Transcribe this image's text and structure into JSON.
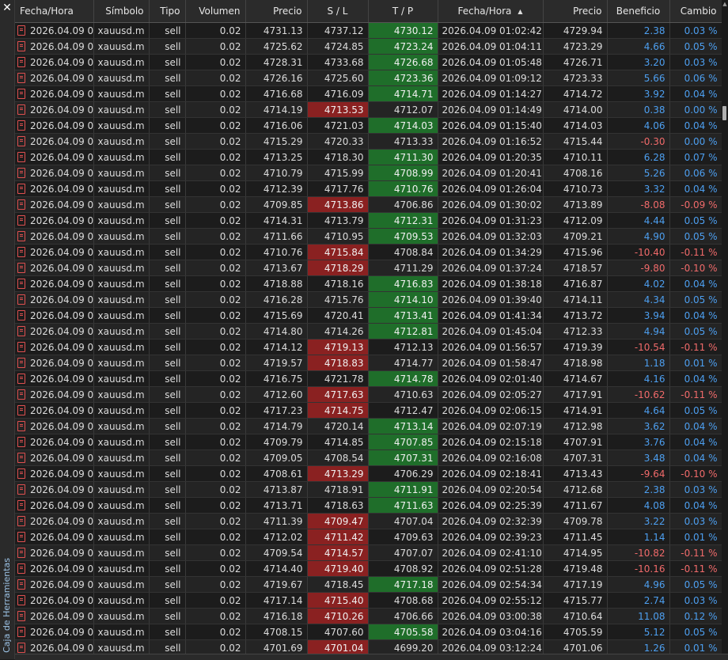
{
  "panel": {
    "title": "Caja de Herramientas",
    "close_icon": "close-icon"
  },
  "columns": [
    "Fecha/Hora",
    "Símbolo",
    "Tipo",
    "Volumen",
    "Precio",
    "S / L",
    "T / P",
    "Fecha/Hora",
    "Precio",
    "Beneficio",
    "Cambio"
  ],
  "sort": {
    "column": 7,
    "direction": "ascending",
    "icon": "sort-up-icon"
  },
  "colors": {
    "sl_hit": "#8a2121",
    "tp_hit": "#1f6e2a",
    "positive": "#4d9ff0",
    "negative": "#f06a6a"
  },
  "rows": [
    {
      "open_time": "2026.04.09 0...",
      "symbol": "xauusd.m",
      "type": "sell",
      "volume": "0.02",
      "open_price": "4731.13",
      "sl": "4737.12",
      "tp": "4730.12",
      "close_time": "2026.04.09 01:02:42",
      "close_price": "4729.94",
      "profit": "2.38",
      "change": "0.03 %",
      "hit": "tp"
    },
    {
      "open_time": "2026.04.09 0...",
      "symbol": "xauusd.m",
      "type": "sell",
      "volume": "0.02",
      "open_price": "4725.62",
      "sl": "4724.85",
      "tp": "4723.24",
      "close_time": "2026.04.09 01:04:11",
      "close_price": "4723.29",
      "profit": "4.66",
      "change": "0.05 %",
      "hit": "tp"
    },
    {
      "open_time": "2026.04.09 0...",
      "symbol": "xauusd.m",
      "type": "sell",
      "volume": "0.02",
      "open_price": "4728.31",
      "sl": "4733.68",
      "tp": "4726.68",
      "close_time": "2026.04.09 01:05:48",
      "close_price": "4726.71",
      "profit": "3.20",
      "change": "0.03 %",
      "hit": "tp"
    },
    {
      "open_time": "2026.04.09 0...",
      "symbol": "xauusd.m",
      "type": "sell",
      "volume": "0.02",
      "open_price": "4726.16",
      "sl": "4725.60",
      "tp": "4723.36",
      "close_time": "2026.04.09 01:09:12",
      "close_price": "4723.33",
      "profit": "5.66",
      "change": "0.06 %",
      "hit": "tp"
    },
    {
      "open_time": "2026.04.09 0...",
      "symbol": "xauusd.m",
      "type": "sell",
      "volume": "0.02",
      "open_price": "4716.68",
      "sl": "4716.09",
      "tp": "4714.71",
      "close_time": "2026.04.09 01:14:27",
      "close_price": "4714.72",
      "profit": "3.92",
      "change": "0.04 %",
      "hit": "tp"
    },
    {
      "open_time": "2026.04.09 0...",
      "symbol": "xauusd.m",
      "type": "sell",
      "volume": "0.02",
      "open_price": "4714.19",
      "sl": "4713.53",
      "tp": "4712.07",
      "close_time": "2026.04.09 01:14:49",
      "close_price": "4714.00",
      "profit": "0.38",
      "change": "0.00 %",
      "hit": "sl"
    },
    {
      "open_time": "2026.04.09 0...",
      "symbol": "xauusd.m",
      "type": "sell",
      "volume": "0.02",
      "open_price": "4716.06",
      "sl": "4721.03",
      "tp": "4714.03",
      "close_time": "2026.04.09 01:15:40",
      "close_price": "4714.03",
      "profit": "4.06",
      "change": "0.04 %",
      "hit": "tp"
    },
    {
      "open_time": "2026.04.09 0...",
      "symbol": "xauusd.m",
      "type": "sell",
      "volume": "0.02",
      "open_price": "4715.29",
      "sl": "4720.33",
      "tp": "4713.33",
      "close_time": "2026.04.09 01:16:52",
      "close_price": "4715.44",
      "profit": "-0.30",
      "change": "0.00 %",
      "hit": ""
    },
    {
      "open_time": "2026.04.09 0...",
      "symbol": "xauusd.m",
      "type": "sell",
      "volume": "0.02",
      "open_price": "4713.25",
      "sl": "4718.30",
      "tp": "4711.30",
      "close_time": "2026.04.09 01:20:35",
      "close_price": "4710.11",
      "profit": "6.28",
      "change": "0.07 %",
      "hit": "tp"
    },
    {
      "open_time": "2026.04.09 0...",
      "symbol": "xauusd.m",
      "type": "sell",
      "volume": "0.02",
      "open_price": "4710.79",
      "sl": "4715.99",
      "tp": "4708.99",
      "close_time": "2026.04.09 01:20:41",
      "close_price": "4708.16",
      "profit": "5.26",
      "change": "0.06 %",
      "hit": "tp"
    },
    {
      "open_time": "2026.04.09 0...",
      "symbol": "xauusd.m",
      "type": "sell",
      "volume": "0.02",
      "open_price": "4712.39",
      "sl": "4717.76",
      "tp": "4710.76",
      "close_time": "2026.04.09 01:26:04",
      "close_price": "4710.73",
      "profit": "3.32",
      "change": "0.04 %",
      "hit": "tp"
    },
    {
      "open_time": "2026.04.09 0...",
      "symbol": "xauusd.m",
      "type": "sell",
      "volume": "0.02",
      "open_price": "4709.85",
      "sl": "4713.86",
      "tp": "4706.86",
      "close_time": "2026.04.09 01:30:02",
      "close_price": "4713.89",
      "profit": "-8.08",
      "change": "-0.09 %",
      "hit": "sl"
    },
    {
      "open_time": "2026.04.09 0...",
      "symbol": "xauusd.m",
      "type": "sell",
      "volume": "0.02",
      "open_price": "4714.31",
      "sl": "4713.79",
      "tp": "4712.31",
      "close_time": "2026.04.09 01:31:23",
      "close_price": "4712.09",
      "profit": "4.44",
      "change": "0.05 %",
      "hit": "tp"
    },
    {
      "open_time": "2026.04.09 0...",
      "symbol": "xauusd.m",
      "type": "sell",
      "volume": "0.02",
      "open_price": "4711.66",
      "sl": "4710.95",
      "tp": "4709.53",
      "close_time": "2026.04.09 01:32:03",
      "close_price": "4709.21",
      "profit": "4.90",
      "change": "0.05 %",
      "hit": "tp"
    },
    {
      "open_time": "2026.04.09 0...",
      "symbol": "xauusd.m",
      "type": "sell",
      "volume": "0.02",
      "open_price": "4710.76",
      "sl": "4715.84",
      "tp": "4708.84",
      "close_time": "2026.04.09 01:34:29",
      "close_price": "4715.96",
      "profit": "-10.40",
      "change": "-0.11 %",
      "hit": "sl"
    },
    {
      "open_time": "2026.04.09 0...",
      "symbol": "xauusd.m",
      "type": "sell",
      "volume": "0.02",
      "open_price": "4713.67",
      "sl": "4718.29",
      "tp": "4711.29",
      "close_time": "2026.04.09 01:37:24",
      "close_price": "4718.57",
      "profit": "-9.80",
      "change": "-0.10 %",
      "hit": "sl"
    },
    {
      "open_time": "2026.04.09 0...",
      "symbol": "xauusd.m",
      "type": "sell",
      "volume": "0.02",
      "open_price": "4718.88",
      "sl": "4718.16",
      "tp": "4716.83",
      "close_time": "2026.04.09 01:38:18",
      "close_price": "4716.87",
      "profit": "4.02",
      "change": "0.04 %",
      "hit": "tp"
    },
    {
      "open_time": "2026.04.09 0...",
      "symbol": "xauusd.m",
      "type": "sell",
      "volume": "0.02",
      "open_price": "4716.28",
      "sl": "4715.76",
      "tp": "4714.10",
      "close_time": "2026.04.09 01:39:40",
      "close_price": "4714.11",
      "profit": "4.34",
      "change": "0.05 %",
      "hit": "tp"
    },
    {
      "open_time": "2026.04.09 0...",
      "symbol": "xauusd.m",
      "type": "sell",
      "volume": "0.02",
      "open_price": "4715.69",
      "sl": "4720.41",
      "tp": "4713.41",
      "close_time": "2026.04.09 01:41:34",
      "close_price": "4713.72",
      "profit": "3.94",
      "change": "0.04 %",
      "hit": "tp"
    },
    {
      "open_time": "2026.04.09 0...",
      "symbol": "xauusd.m",
      "type": "sell",
      "volume": "0.02",
      "open_price": "4714.80",
      "sl": "4714.26",
      "tp": "4712.81",
      "close_time": "2026.04.09 01:45:04",
      "close_price": "4712.33",
      "profit": "4.94",
      "change": "0.05 %",
      "hit": "tp"
    },
    {
      "open_time": "2026.04.09 0...",
      "symbol": "xauusd.m",
      "type": "sell",
      "volume": "0.02",
      "open_price": "4714.12",
      "sl": "4719.13",
      "tp": "4712.13",
      "close_time": "2026.04.09 01:56:57",
      "close_price": "4719.39",
      "profit": "-10.54",
      "change": "-0.11 %",
      "hit": "sl"
    },
    {
      "open_time": "2026.04.09 0...",
      "symbol": "xauusd.m",
      "type": "sell",
      "volume": "0.02",
      "open_price": "4719.57",
      "sl": "4718.83",
      "tp": "4714.77",
      "close_time": "2026.04.09 01:58:47",
      "close_price": "4718.98",
      "profit": "1.18",
      "change": "0.01 %",
      "hit": "sl"
    },
    {
      "open_time": "2026.04.09 0...",
      "symbol": "xauusd.m",
      "type": "sell",
      "volume": "0.02",
      "open_price": "4716.75",
      "sl": "4721.78",
      "tp": "4714.78",
      "close_time": "2026.04.09 02:01:40",
      "close_price": "4714.67",
      "profit": "4.16",
      "change": "0.04 %",
      "hit": "tp"
    },
    {
      "open_time": "2026.04.09 0...",
      "symbol": "xauusd.m",
      "type": "sell",
      "volume": "0.02",
      "open_price": "4712.60",
      "sl": "4717.63",
      "tp": "4710.63",
      "close_time": "2026.04.09 02:05:27",
      "close_price": "4717.91",
      "profit": "-10.62",
      "change": "-0.11 %",
      "hit": "sl"
    },
    {
      "open_time": "2026.04.09 0...",
      "symbol": "xauusd.m",
      "type": "sell",
      "volume": "0.02",
      "open_price": "4717.23",
      "sl": "4714.75",
      "tp": "4712.47",
      "close_time": "2026.04.09 02:06:15",
      "close_price": "4714.91",
      "profit": "4.64",
      "change": "0.05 %",
      "hit": "sl"
    },
    {
      "open_time": "2026.04.09 0...",
      "symbol": "xauusd.m",
      "type": "sell",
      "volume": "0.02",
      "open_price": "4714.79",
      "sl": "4720.14",
      "tp": "4713.14",
      "close_time": "2026.04.09 02:07:19",
      "close_price": "4712.98",
      "profit": "3.62",
      "change": "0.04 %",
      "hit": "tp"
    },
    {
      "open_time": "2026.04.09 0...",
      "symbol": "xauusd.m",
      "type": "sell",
      "volume": "0.02",
      "open_price": "4709.79",
      "sl": "4714.85",
      "tp": "4707.85",
      "close_time": "2026.04.09 02:15:18",
      "close_price": "4707.91",
      "profit": "3.76",
      "change": "0.04 %",
      "hit": "tp"
    },
    {
      "open_time": "2026.04.09 0...",
      "symbol": "xauusd.m",
      "type": "sell",
      "volume": "0.02",
      "open_price": "4709.05",
      "sl": "4708.54",
      "tp": "4707.31",
      "close_time": "2026.04.09 02:16:08",
      "close_price": "4707.31",
      "profit": "3.48",
      "change": "0.04 %",
      "hit": "tp"
    },
    {
      "open_time": "2026.04.09 0...",
      "symbol": "xauusd.m",
      "type": "sell",
      "volume": "0.02",
      "open_price": "4708.61",
      "sl": "4713.29",
      "tp": "4706.29",
      "close_time": "2026.04.09 02:18:41",
      "close_price": "4713.43",
      "profit": "-9.64",
      "change": "-0.10 %",
      "hit": "sl"
    },
    {
      "open_time": "2026.04.09 0...",
      "symbol": "xauusd.m",
      "type": "sell",
      "volume": "0.02",
      "open_price": "4713.87",
      "sl": "4718.91",
      "tp": "4711.91",
      "close_time": "2026.04.09 02:20:54",
      "close_price": "4712.68",
      "profit": "2.38",
      "change": "0.03 %",
      "hit": "tp"
    },
    {
      "open_time": "2026.04.09 0...",
      "symbol": "xauusd.m",
      "type": "sell",
      "volume": "0.02",
      "open_price": "4713.71",
      "sl": "4718.63",
      "tp": "4711.63",
      "close_time": "2026.04.09 02:25:39",
      "close_price": "4711.67",
      "profit": "4.08",
      "change": "0.04 %",
      "hit": "tp"
    },
    {
      "open_time": "2026.04.09 0...",
      "symbol": "xauusd.m",
      "type": "sell",
      "volume": "0.02",
      "open_price": "4711.39",
      "sl": "4709.47",
      "tp": "4707.04",
      "close_time": "2026.04.09 02:32:39",
      "close_price": "4709.78",
      "profit": "3.22",
      "change": "0.03 %",
      "hit": "sl"
    },
    {
      "open_time": "2026.04.09 0...",
      "symbol": "xauusd.m",
      "type": "sell",
      "volume": "0.02",
      "open_price": "4712.02",
      "sl": "4711.42",
      "tp": "4709.63",
      "close_time": "2026.04.09 02:39:23",
      "close_price": "4711.45",
      "profit": "1.14",
      "change": "0.01 %",
      "hit": "sl"
    },
    {
      "open_time": "2026.04.09 0...",
      "symbol": "xauusd.m",
      "type": "sell",
      "volume": "0.02",
      "open_price": "4709.54",
      "sl": "4714.57",
      "tp": "4707.07",
      "close_time": "2026.04.09 02:41:10",
      "close_price": "4714.95",
      "profit": "-10.82",
      "change": "-0.11 %",
      "hit": "sl"
    },
    {
      "open_time": "2026.04.09 0...",
      "symbol": "xauusd.m",
      "type": "sell",
      "volume": "0.02",
      "open_price": "4714.40",
      "sl": "4719.40",
      "tp": "4708.92",
      "close_time": "2026.04.09 02:51:28",
      "close_price": "4719.48",
      "profit": "-10.16",
      "change": "-0.11 %",
      "hit": "sl"
    },
    {
      "open_time": "2026.04.09 0...",
      "symbol": "xauusd.m",
      "type": "sell",
      "volume": "0.02",
      "open_price": "4719.67",
      "sl": "4718.45",
      "tp": "4717.18",
      "close_time": "2026.04.09 02:54:34",
      "close_price": "4717.19",
      "profit": "4.96",
      "change": "0.05 %",
      "hit": "tp"
    },
    {
      "open_time": "2026.04.09 0...",
      "symbol": "xauusd.m",
      "type": "sell",
      "volume": "0.02",
      "open_price": "4717.14",
      "sl": "4715.40",
      "tp": "4708.68",
      "close_time": "2026.04.09 02:55:12",
      "close_price": "4715.77",
      "profit": "2.74",
      "change": "0.03 %",
      "hit": "sl"
    },
    {
      "open_time": "2026.04.09 0...",
      "symbol": "xauusd.m",
      "type": "sell",
      "volume": "0.02",
      "open_price": "4716.18",
      "sl": "4710.26",
      "tp": "4706.66",
      "close_time": "2026.04.09 03:00:38",
      "close_price": "4710.64",
      "profit": "11.08",
      "change": "0.12 %",
      "hit": "sl"
    },
    {
      "open_time": "2026.04.09 0...",
      "symbol": "xauusd.m",
      "type": "sell",
      "volume": "0.02",
      "open_price": "4708.15",
      "sl": "4707.60",
      "tp": "4705.58",
      "close_time": "2026.04.09 03:04:16",
      "close_price": "4705.59",
      "profit": "5.12",
      "change": "0.05 %",
      "hit": "tp"
    },
    {
      "open_time": "2026.04.09 0...",
      "symbol": "xauusd.m",
      "type": "sell",
      "volume": "0.02",
      "open_price": "4701.69",
      "sl": "4701.04",
      "tp": "4699.20",
      "close_time": "2026.04.09 03:12:24",
      "close_price": "4701.06",
      "profit": "1.26",
      "change": "0.01 %",
      "hit": "sl"
    }
  ]
}
